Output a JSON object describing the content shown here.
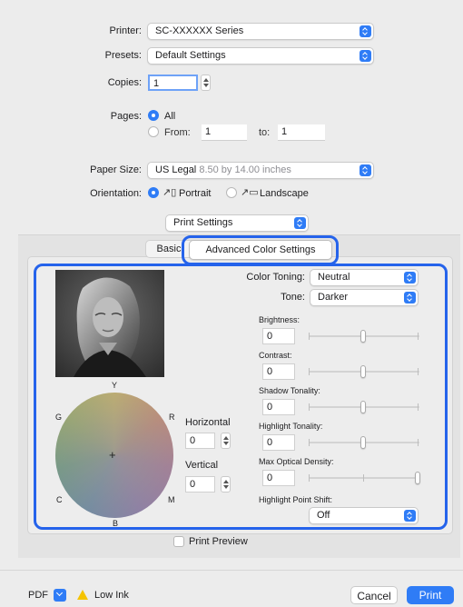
{
  "printer": {
    "label": "Printer:",
    "value": "SC-XXXXXX Series"
  },
  "presets": {
    "label": "Presets:",
    "value": "Default Settings"
  },
  "copies": {
    "label": "Copies:",
    "value": "1"
  },
  "pages": {
    "label": "Pages:",
    "all_label": "All",
    "from_label": "From:",
    "from_value": "1",
    "to_label": "to:",
    "to_value": "1"
  },
  "paper_size": {
    "label": "Paper Size:",
    "value": "US Legal",
    "detail": "8.50 by 14.00 inches"
  },
  "orientation": {
    "label": "Orientation:",
    "portrait_label": "Portrait",
    "landscape_label": "Landscape"
  },
  "section_select": {
    "value": "Print Settings"
  },
  "tabs": {
    "basic": "Basic",
    "advanced": "Advanced Color Settings"
  },
  "color_toning": {
    "label": "Color Toning:",
    "value": "Neutral"
  },
  "tone": {
    "label": "Tone:",
    "value": "Darker"
  },
  "sliders": [
    {
      "label": "Brightness:",
      "value": "0",
      "level": 0.5
    },
    {
      "label": "Contrast:",
      "value": "0",
      "level": 0.5
    },
    {
      "label": "Shadow Tonality:",
      "value": "0",
      "level": 0.5
    },
    {
      "label": "Highlight Tonality:",
      "value": "0",
      "level": 0.5
    },
    {
      "label": "Max Optical Density:",
      "value": "0",
      "level": 1.0
    }
  ],
  "highlight_point_shift": {
    "label": "Highlight Point Shift:",
    "value": "Off"
  },
  "color_wheel": {
    "labels": {
      "y": "Y",
      "r": "R",
      "m": "M",
      "b": "B",
      "c": "C",
      "g": "G"
    },
    "horizontal_label": "Horizontal",
    "horizontal_value": "0",
    "vertical_label": "Vertical",
    "vertical_value": "0"
  },
  "print_preview": {
    "label": "Print Preview",
    "checked": false
  },
  "footer": {
    "pdf_label": "PDF",
    "low_ink_label": "Low Ink",
    "cancel_label": "Cancel",
    "print_label": "Print"
  },
  "colors": {
    "accent": "#2f7cf6",
    "highlight_outline": "#2563eb",
    "warning": "#f5c300"
  }
}
